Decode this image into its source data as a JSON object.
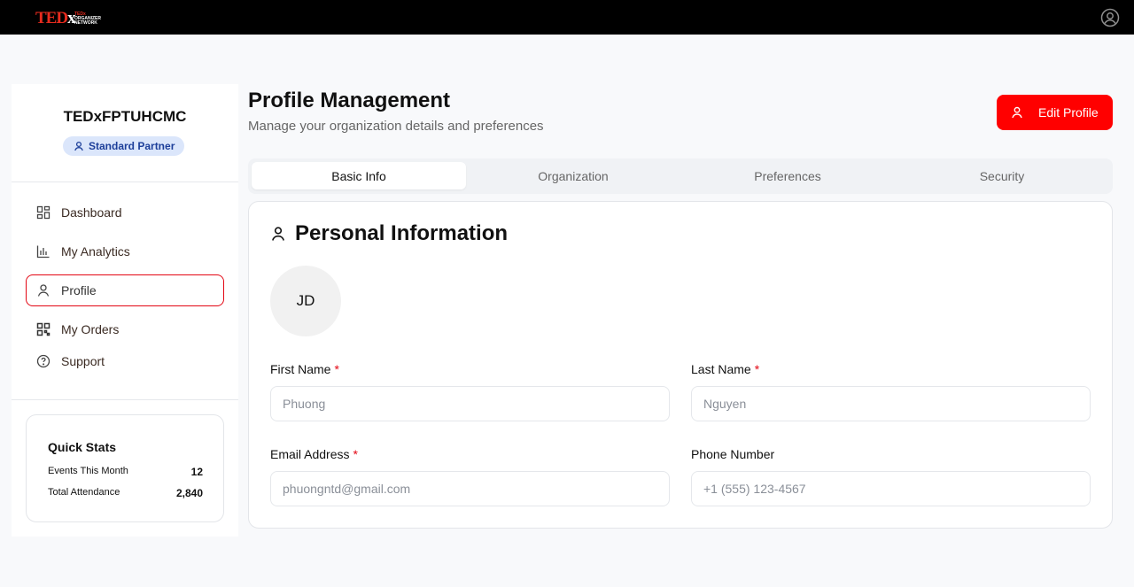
{
  "topbar": {
    "logo_prefix": "TED",
    "logo_suffix": "x",
    "logo_sub": [
      "TEDx",
      "ORGANIZER",
      "NETWORK"
    ]
  },
  "sidebar": {
    "org_name": "TEDxFPTUHCMC",
    "badge": "Standard Partner",
    "nav": [
      {
        "label": "Dashboard",
        "icon": "dashboard-icon"
      },
      {
        "label": "My Analytics",
        "icon": "bar-chart-icon"
      },
      {
        "label": "Profile",
        "icon": "user-icon",
        "active": true
      },
      {
        "label": "My Orders",
        "icon": "grid-icon"
      },
      {
        "label": "Support",
        "icon": "help-circle-icon"
      }
    ],
    "stats": {
      "title": "Quick Stats",
      "rows": [
        {
          "label": "Events This Month",
          "value": "12"
        },
        {
          "label": "Total Attendance",
          "value": "2,840"
        }
      ]
    }
  },
  "header": {
    "title": "Profile Management",
    "subtitle": "Manage your organization details and preferences",
    "edit_button": "Edit Profile"
  },
  "tabs": [
    "Basic Info",
    "Organization",
    "Preferences",
    "Security"
  ],
  "active_tab": "Basic Info",
  "personal": {
    "title": "Personal Information",
    "avatar_initials": "JD",
    "fields": {
      "first_name": {
        "label": "First Name",
        "value": "Phuong",
        "required": "*"
      },
      "last_name": {
        "label": "Last Name",
        "value": "Nguyen",
        "required": "*"
      },
      "email": {
        "label": "Email Address",
        "value": "phuongntd@gmail.com",
        "required": "*"
      },
      "phone": {
        "label": "Phone Number",
        "value": "+1 (555) 123-4567"
      }
    }
  },
  "colors": {
    "accent": "#ff0000",
    "badge_bg": "#dbe6fb",
    "badge_text": "#1d3f9a",
    "topbar": "#000000"
  }
}
